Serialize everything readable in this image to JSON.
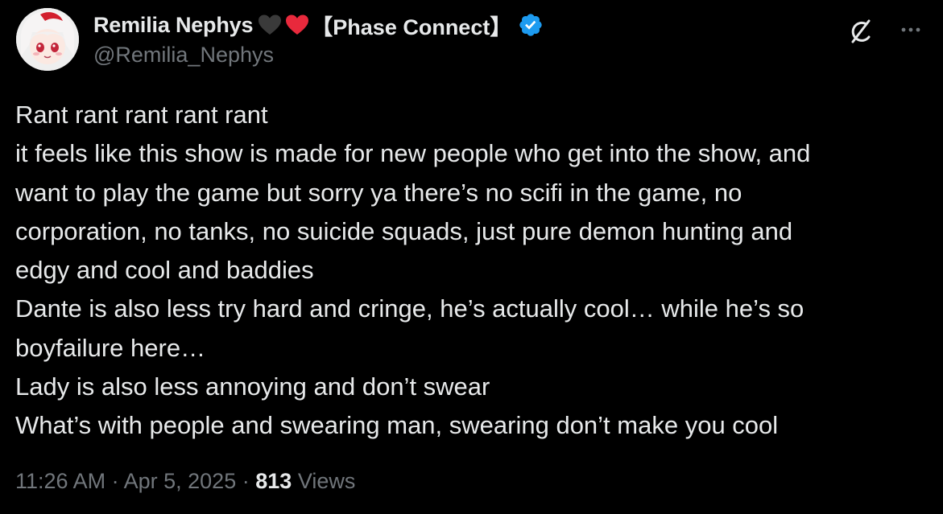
{
  "author": {
    "display_name": "Remilia Nephys",
    "affiliation": "【Phase Connect】",
    "handle": "@Remilia_Nephys",
    "emoji": [
      "black-heart-icon",
      "red-heart-icon"
    ],
    "verified": true
  },
  "actions": {
    "grok_icon": "grok-icon",
    "more_icon": "more-icon"
  },
  "tweet": {
    "lines": [
      "Rant rant rant rant rant",
      "it feels like this show is made for new people who get into the show, and",
      "want to play the game but sorry ya there’s no scifi in the game, no",
      "corporation, no tanks, no suicide squads, just pure demon hunting and",
      "edgy and cool and baddies",
      "Dante is also less try hard and cringe, he’s actually cool… while he’s so",
      "boyfailure here…",
      "Lady is also less annoying and don’t swear",
      "What’s with people and swearing man, swearing don’t make you cool"
    ]
  },
  "meta": {
    "time": "11:26 AM",
    "separator": "·",
    "date": "Apr 5, 2025",
    "views_count": "813",
    "views_label": "Views"
  },
  "colors": {
    "background": "#000000",
    "text": "#e7e9ea",
    "secondary_text": "#71767b",
    "verified": "#1d9bf0",
    "red_heart": "#e8293c",
    "black_heart": "#3a3a3a"
  }
}
